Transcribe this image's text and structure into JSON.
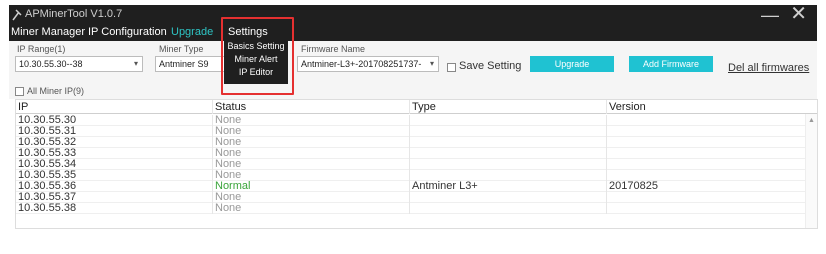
{
  "window": {
    "title": "APMinerTool V1.0.7",
    "minimize": "—",
    "close": "✕"
  },
  "menu": {
    "items": [
      "Miner Manager",
      "IP Configuration",
      "Upgrade",
      "Settings"
    ],
    "active": "Upgrade",
    "settings_dropdown": [
      "Basics Setting",
      "Miner Alert",
      "IP Editor"
    ]
  },
  "toolbar": {
    "ip_range_label": "IP Range(1)",
    "ip_range_value": "10.30.55.30--38",
    "miner_type_label": "Miner Type",
    "miner_type_value": "Antminer S9",
    "firmware_label": "Firmware Name",
    "firmware_value": "Antminer-L3+-201708251737-",
    "save_setting_label": "Save Setting",
    "upgrade_label": "Upgrade",
    "add_firmware_label": "Add Firmware",
    "del_all_label": "Del all firmwares",
    "all_miner_label": "All  Miner IP(9)"
  },
  "table": {
    "columns": [
      "IP",
      "Status",
      "Type",
      "Version"
    ],
    "rows": [
      {
        "ip": "10.30.55.30",
        "status": "None",
        "type": "",
        "version": ""
      },
      {
        "ip": "10.30.55.31",
        "status": "None",
        "type": "",
        "version": ""
      },
      {
        "ip": "10.30.55.32",
        "status": "None",
        "type": "",
        "version": ""
      },
      {
        "ip": "10.30.55.33",
        "status": "None",
        "type": "",
        "version": ""
      },
      {
        "ip": "10.30.55.34",
        "status": "None",
        "type": "",
        "version": ""
      },
      {
        "ip": "10.30.55.35",
        "status": "None",
        "type": "",
        "version": ""
      },
      {
        "ip": "10.30.55.36",
        "status": "Normal",
        "type": "Antminer L3+",
        "version": "20170825"
      },
      {
        "ip": "10.30.55.37",
        "status": "None",
        "type": "",
        "version": ""
      },
      {
        "ip": "10.30.55.38",
        "status": "None",
        "type": "",
        "version": ""
      }
    ]
  },
  "colors": {
    "accent": "#2ec4c4",
    "button": "#1fc2d2",
    "highlight": "#e53030",
    "titlebar": "#1f1f1f",
    "status_normal": "#3aa43a"
  },
  "icons": {
    "app": "miner-pick-icon",
    "dropdown_caret": "chevron-down-icon",
    "checkbox": "checkbox-icon"
  }
}
